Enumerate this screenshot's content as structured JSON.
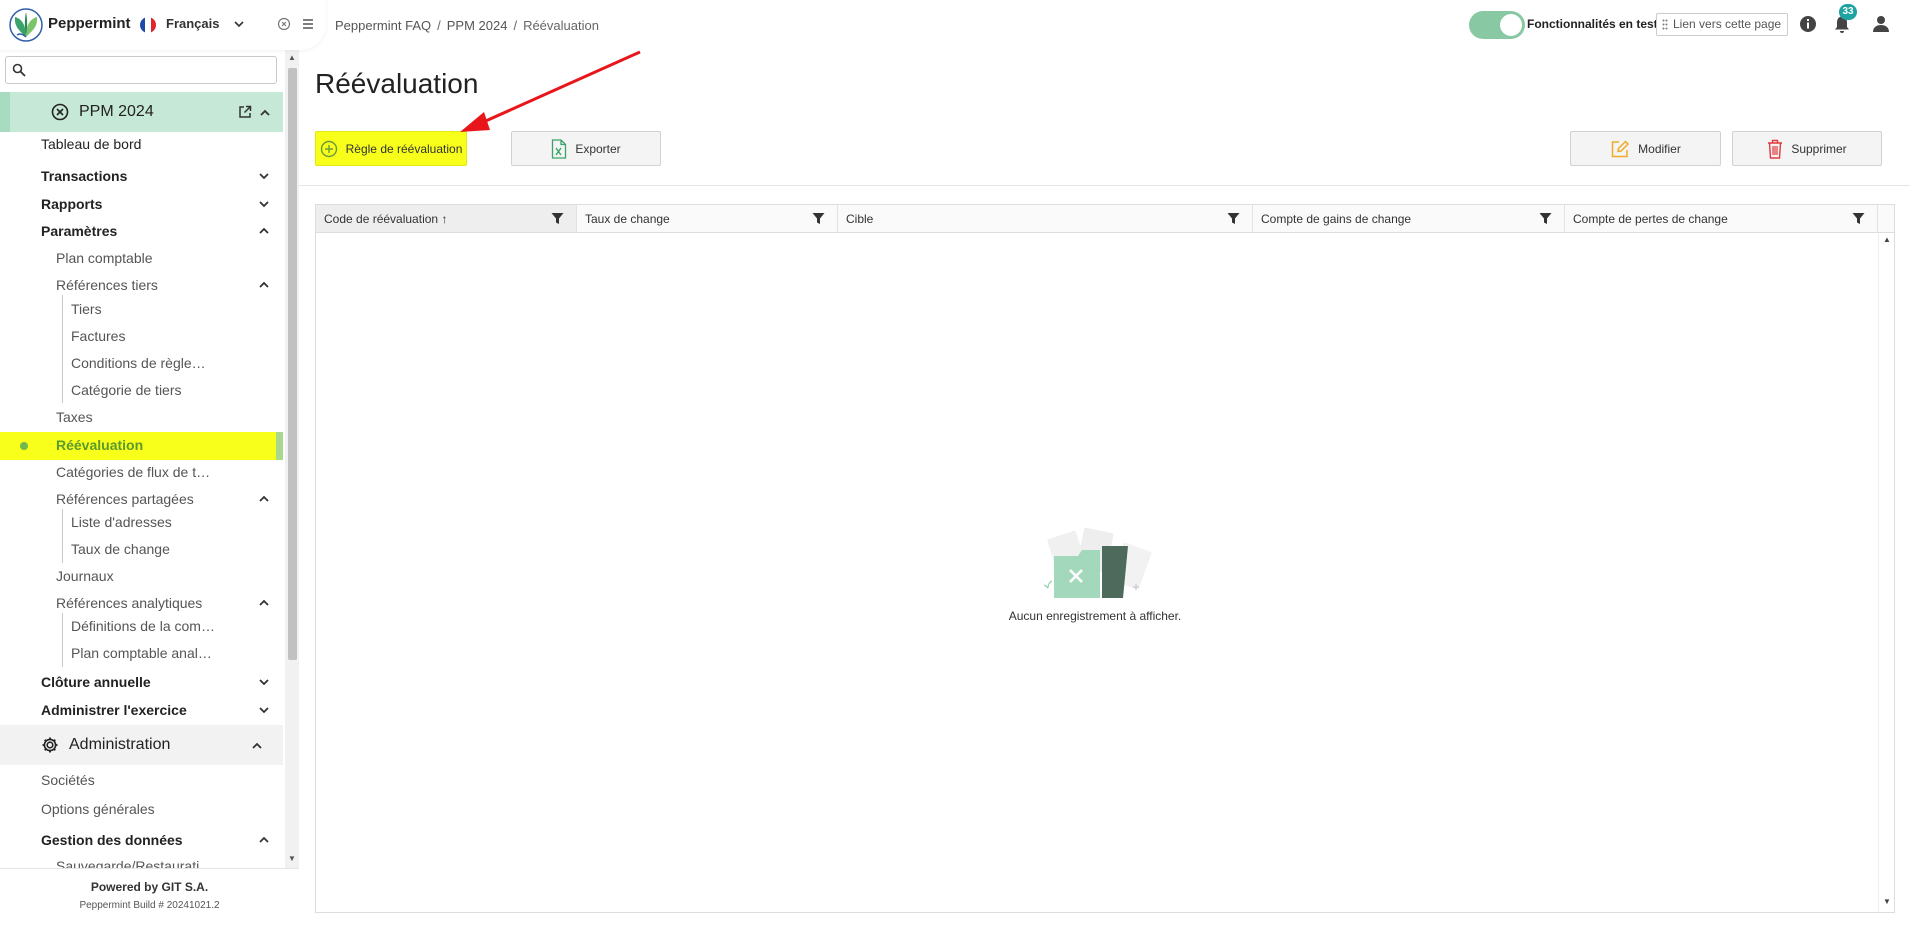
{
  "app": {
    "name": "Peppermint",
    "language": "Français"
  },
  "search": {
    "placeholder": "",
    "value": ""
  },
  "sidebar": {
    "section_ppm": {
      "label": "PPM 2024"
    },
    "items": {
      "tableau_de_bord": "Tableau de bord",
      "transactions": "Transactions",
      "rapports": "Rapports",
      "parametres": "Paramètres",
      "plan_comptable": "Plan comptable",
      "references_tiers": "Références tiers",
      "tiers": "Tiers",
      "factures": "Factures",
      "conditions": "Conditions de règle…",
      "categorie_tiers": "Catégorie de tiers",
      "taxes": "Taxes",
      "reevaluation": "Réévaluation",
      "categories_flux": "Catégories de flux de t…",
      "references_partagees": "Références partagées",
      "liste_adresses": "Liste d'adresses",
      "taux_de_change": "Taux de change",
      "journaux": "Journaux",
      "references_analytiques": "Références analytiques",
      "definitions": "Définitions de la com…",
      "plan_comptable_anal": "Plan comptable anal…",
      "cloture": "Clôture annuelle",
      "administrer": "Administrer l'exercice"
    },
    "section_admin": {
      "label": "Administration"
    },
    "admin_items": {
      "societes": "Sociétés",
      "options": "Options générales",
      "gestion": "Gestion des données",
      "sauvegarde": "Sauvegarde/Restaurati…"
    },
    "footer": {
      "powered": "Powered by GIT S.A.",
      "build": "Peppermint Build # 20241021.2"
    }
  },
  "topbar": {
    "breadcrumb": [
      "Peppermint FAQ",
      "PPM 2024",
      "Réévaluation"
    ],
    "features_label": "Fonctionnalités en test",
    "features_enabled": true,
    "page_link": "Lien vers cette page",
    "notifications": "33"
  },
  "main": {
    "title": "Réévaluation",
    "buttons": {
      "add": "Règle de réévaluation",
      "export": "Exporter",
      "modify": "Modifier",
      "delete": "Supprimer"
    },
    "grid": {
      "columns": [
        "Code de réévaluation",
        "Taux de change",
        "Cible",
        "Compte de gains de change",
        "Compte de pertes de change"
      ],
      "sort_indicator": "↑",
      "empty_text": "Aucun enregistrement à afficher."
    }
  },
  "colors": {
    "highlight": "#f7ff1a",
    "active_section": "#c6e8d6",
    "toggle": "#88c9a4",
    "badge": "#1fa3a0",
    "annotation_arrow": "#e8161b"
  }
}
